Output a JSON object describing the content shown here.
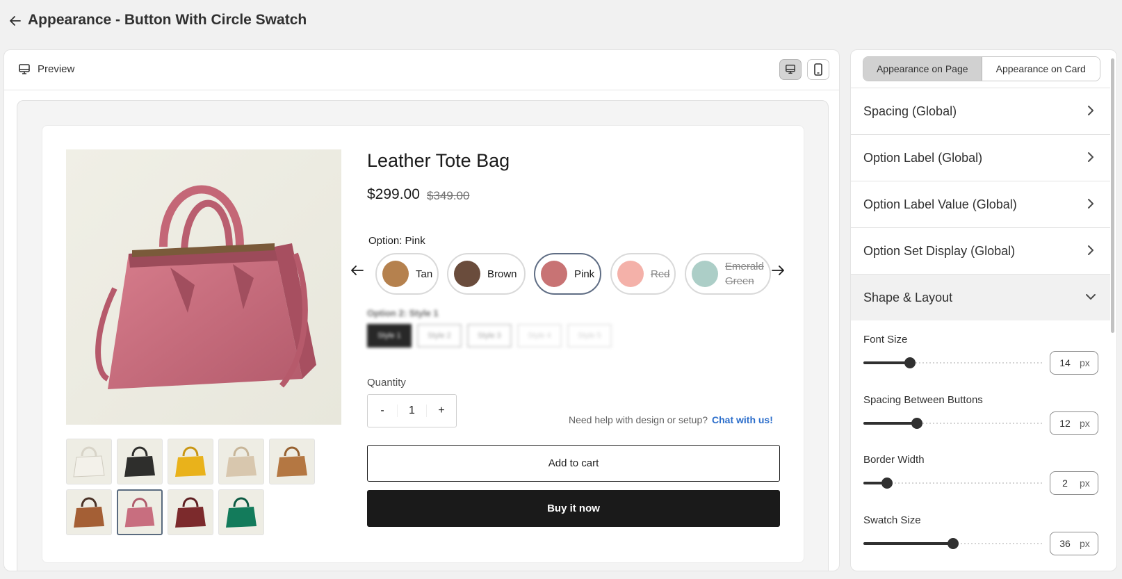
{
  "header": {
    "title": "Appearance - Button With Circle Swatch"
  },
  "preview": {
    "label": "Preview"
  },
  "product": {
    "title": "Leather Tote Bag",
    "price": "$299.00",
    "compare_price": "$349.00",
    "option_label": "Option: Pink",
    "swatches": [
      {
        "label": "Tan",
        "color": "#b5814e",
        "available": true,
        "selected": false
      },
      {
        "label": "Brown",
        "color": "#6a4c3c",
        "available": true,
        "selected": false
      },
      {
        "label": "Pink",
        "color": "#c87374",
        "available": true,
        "selected": true
      },
      {
        "label": "Red",
        "color": "#f2a39a",
        "available": false,
        "selected": false
      },
      {
        "label_line1": "Emerald",
        "label_line2": "Green",
        "color": "#9dc5bd",
        "available": false,
        "selected": false
      }
    ],
    "option2_label": "Option 2: Style 1",
    "styles": [
      "Style 1",
      "Style 2",
      "Style 3",
      "Style 4",
      "Style 5"
    ],
    "quantity_label": "Quantity",
    "quantity": "1",
    "qty_minus": "-",
    "qty_plus": "+",
    "help_text": "Need help with design or setup?",
    "help_link": "Chat with us!",
    "add_to_cart": "Add to cart",
    "buy_now": "Buy it now",
    "thumbnail_colors": [
      "#f3f1ea",
      "#2e2e2c",
      "#e9b21b",
      "#d8c7ae",
      "#b47742",
      "#a45f35",
      "#c86e7f",
      "#7c2a2c",
      "#137b5b"
    ]
  },
  "settings": {
    "tabs": [
      {
        "label": "Appearance on Page",
        "active": true
      },
      {
        "label": "Appearance on Card",
        "active": false
      }
    ],
    "sections": [
      {
        "label": "Spacing (Global)"
      },
      {
        "label": "Option Label (Global)"
      },
      {
        "label": "Option Label Value (Global)"
      },
      {
        "label": "Option Set Display (Global)"
      },
      {
        "label": "Shape & Layout"
      }
    ],
    "controls": [
      {
        "label": "Font Size",
        "value": "14",
        "unit": "px",
        "fraction": 0.26
      },
      {
        "label": "Spacing Between Buttons",
        "value": "12",
        "unit": "px",
        "fraction": 0.3
      },
      {
        "label": "Border Width",
        "value": "2",
        "unit": "px",
        "fraction": 0.13
      },
      {
        "label": "Swatch Size",
        "value": "36",
        "unit": "px",
        "fraction": 0.5
      }
    ]
  }
}
